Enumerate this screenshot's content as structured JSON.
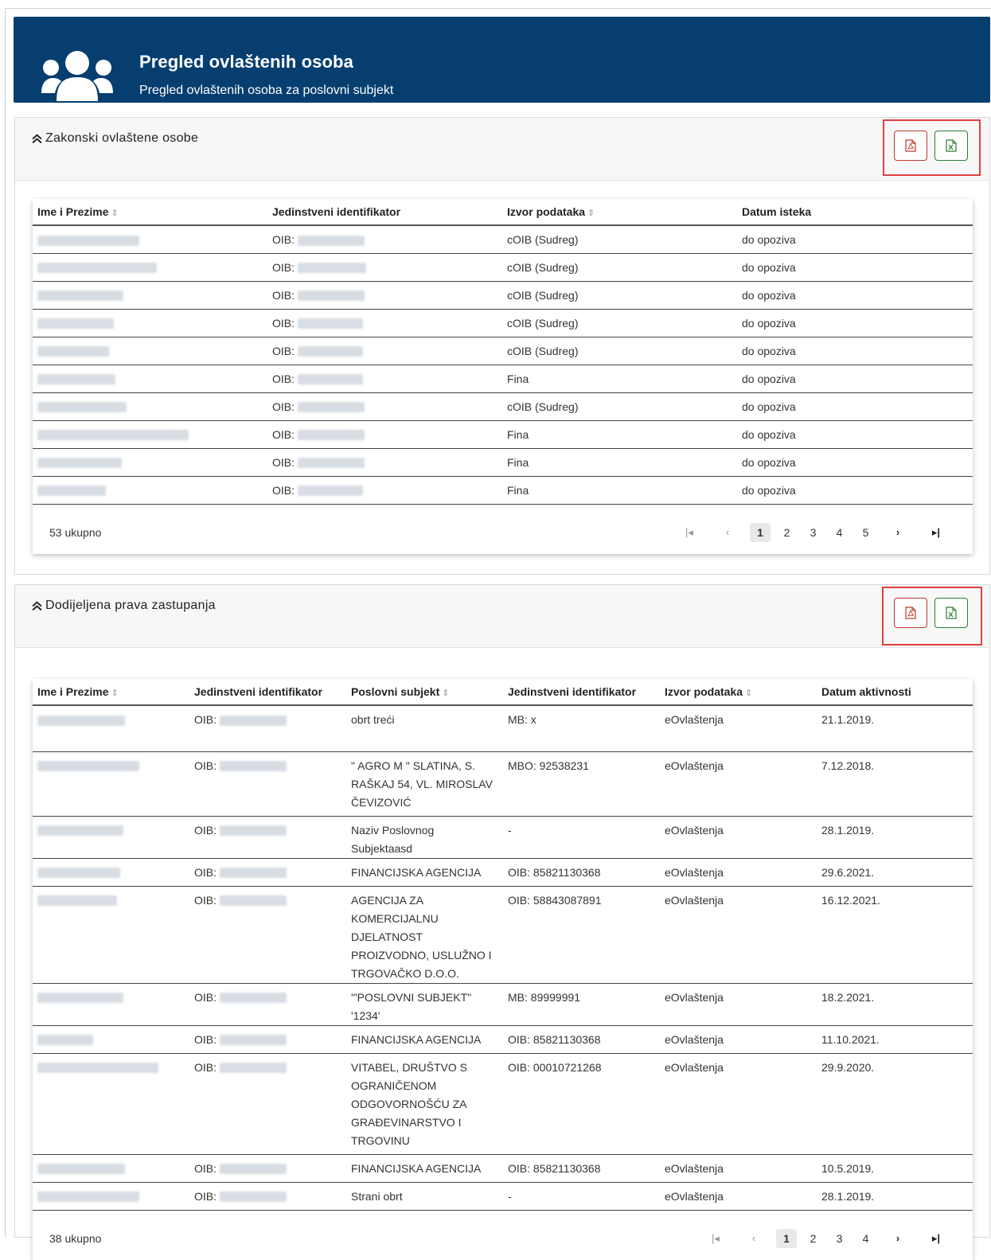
{
  "header": {
    "title": "Pregled ovlaštenih osoba",
    "subtitle": "Pregled ovlaštenih osoba za poslovni subjekt",
    "icon": "users-icon"
  },
  "legal": {
    "title": "Zakonski ovlaštene osobe",
    "columns": [
      "Ime i Prezime",
      "Jedinstveni identifikator",
      "Izvor podataka",
      "Datum isteka"
    ],
    "rows": [
      {
        "oib_prefix": "OIB:",
        "source": "cOIB (Sudreg)",
        "expiry": "do opoziva"
      },
      {
        "oib_prefix": "OIB:",
        "source": "cOIB (Sudreg)",
        "expiry": "do opoziva"
      },
      {
        "oib_prefix": "OIB:",
        "source": "cOIB (Sudreg)",
        "expiry": "do opoziva"
      },
      {
        "oib_prefix": "OIB:",
        "source": "cOIB (Sudreg)",
        "expiry": "do opoziva"
      },
      {
        "oib_prefix": "OIB:",
        "source": "cOIB (Sudreg)",
        "expiry": "do opoziva"
      },
      {
        "oib_prefix": "OIB:",
        "source": "Fina",
        "expiry": "do opoziva"
      },
      {
        "oib_prefix": "OIB:",
        "source": "cOIB (Sudreg)",
        "expiry": "do opoziva"
      },
      {
        "oib_prefix": "OIB:",
        "source": "Fina",
        "expiry": "do opoziva"
      },
      {
        "oib_prefix": "OIB:",
        "source": "Fina",
        "expiry": "do opoziva"
      },
      {
        "oib_prefix": "OIB:",
        "source": "Fina",
        "expiry": "do opoziva"
      }
    ],
    "total": "53 ukupno",
    "pages": [
      "1",
      "2",
      "3",
      "4",
      "5"
    ],
    "current_page": "1"
  },
  "rights": {
    "title": "Dodijeljena prava zastupanja",
    "columns": [
      "Ime i Prezime",
      "Jedinstveni identifikator",
      "Poslovni subjekt",
      "Jedinstveni identifikator",
      "Izvor podataka",
      "Datum aktivnosti"
    ],
    "rows": [
      {
        "oib_prefix": "OIB:",
        "subject": "obrt treći",
        "subject_id": "MB: x",
        "source": "eOvlaštenja",
        "date": "21.1.2019."
      },
      {
        "oib_prefix": "OIB:",
        "subject": "\" AGRO M \" SLATINA, S. RAŠKAJ 54, VL. MIROSLAV ČEVIZOVIĆ",
        "subject_id": "MBO: 92538231",
        "source": "eOvlaštenja",
        "date": "7.12.2018."
      },
      {
        "oib_prefix": "OIB:",
        "subject": "Naziv Poslovnog Subjektaasd",
        "subject_id": "-",
        "source": "eOvlaštenja",
        "date": "28.1.2019."
      },
      {
        "oib_prefix": "OIB:",
        "subject": "FINANCIJSKA AGENCIJA",
        "subject_id": "OIB: 85821130368",
        "source": "eOvlaštenja",
        "date": "29.6.2021."
      },
      {
        "oib_prefix": "OIB:",
        "subject": "AGENCIJA ZA KOMERCIJALNU DJELATNOST PROIZVODNO, USLUŽNO I TRGOVAČKO D.O.O.",
        "subject_id": "OIB: 58843087891",
        "source": "eOvlaštenja",
        "date": "16.12.2021."
      },
      {
        "oib_prefix": "OIB:",
        "subject": "'\"POSLOVNI SUBJEKT\" '1234'",
        "subject_id": "MB: 89999991",
        "source": "eOvlaštenja",
        "date": "18.2.2021."
      },
      {
        "oib_prefix": "OIB:",
        "subject": "FINANCIJSKA AGENCIJA",
        "subject_id": "OIB: 85821130368",
        "source": "eOvlaštenja",
        "date": "11.10.2021."
      },
      {
        "oib_prefix": "OIB:",
        "subject": "VITABEL, DRUŠTVO S OGRANIČENOM ODGOVORNOŠĆU ZA GRAĐEVINARSTVO I TRGOVINU",
        "subject_id": "OIB: 00010721268",
        "source": "eOvlaštenja",
        "date": "29.9.2020."
      },
      {
        "oib_prefix": "OIB:",
        "subject": "FINANCIJSKA AGENCIJA",
        "subject_id": "OIB: 85821130368",
        "source": "eOvlaštenja",
        "date": "10.5.2019."
      },
      {
        "oib_prefix": "OIB:",
        "subject": "Strani obrt",
        "subject_id": "-",
        "source": "eOvlaštenja",
        "date": "28.1.2019."
      }
    ],
    "total": "38 ukupno",
    "pages": [
      "1",
      "2",
      "3",
      "4"
    ],
    "current_page": "1"
  },
  "colors": {
    "header_bg": "#063e70",
    "pdf_red": "#c0392b",
    "excel_green": "#2e7d32",
    "highlight_box": "#e04040"
  }
}
